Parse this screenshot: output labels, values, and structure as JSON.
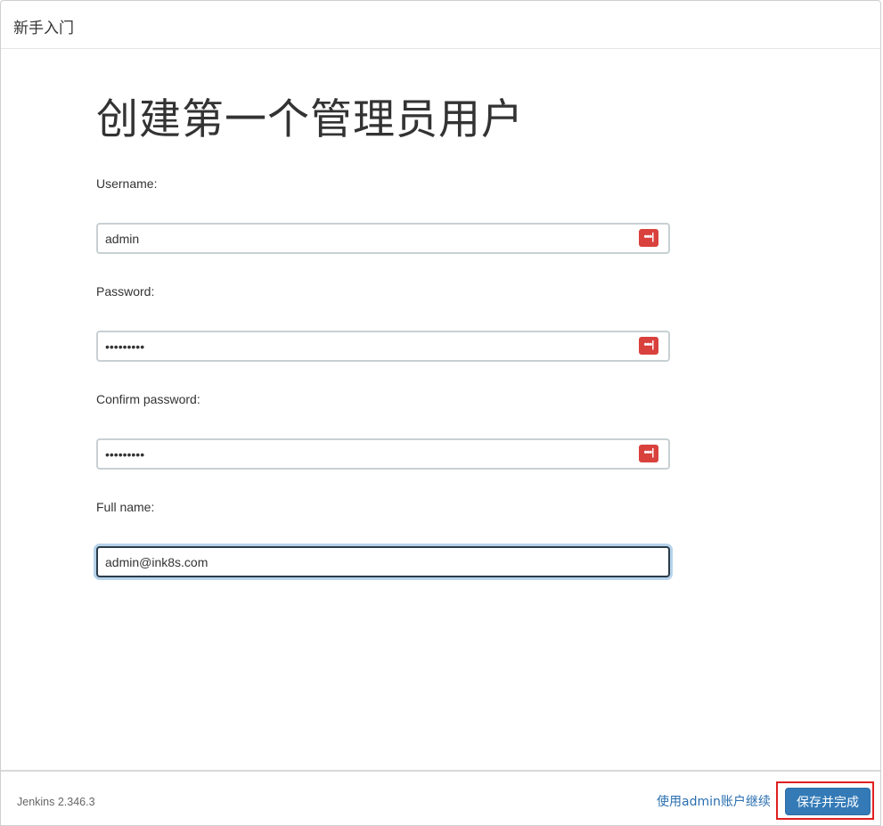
{
  "header": {
    "title": "新手入门"
  },
  "main": {
    "title": "创建第一个管理员用户",
    "fields": [
      {
        "label": "Username:",
        "value": "admin",
        "type": "text"
      },
      {
        "label": "Password:",
        "value": "•••••••••",
        "type": "password"
      },
      {
        "label": "Confirm password:",
        "value": "•••••••••",
        "type": "password"
      },
      {
        "label": "Full name:",
        "value": "admin@ink8s.com",
        "type": "text"
      }
    ]
  },
  "icons": {
    "password_manager": "password-manager-icon",
    "password_manager_glyph": "•••|",
    "password_manager_color": "#d9413d"
  },
  "footer": {
    "version": "Jenkins 2.346.3",
    "continue_label": "使用admin账户继续",
    "save_label": "保存并完成"
  },
  "colors": {
    "primary": "#337ab7",
    "link": "#2a6fb0",
    "highlight_box": "#e02020"
  }
}
